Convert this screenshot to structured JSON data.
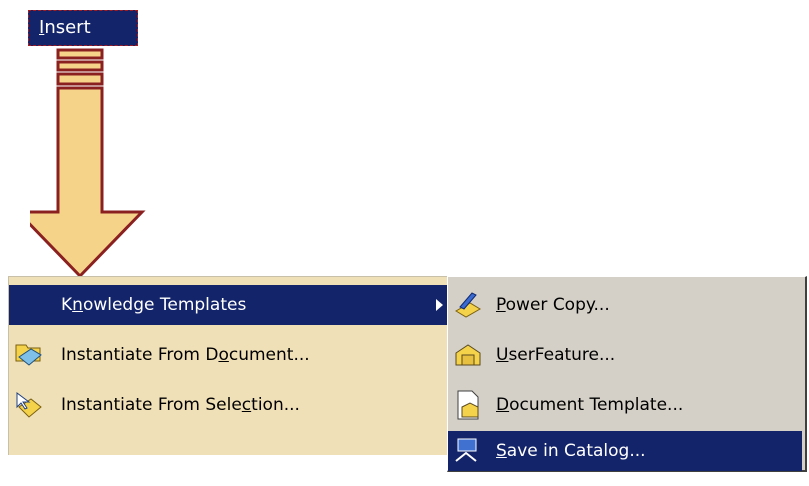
{
  "top_button": {
    "label": "Insert",
    "mnemonic_index": 0
  },
  "left_menu": {
    "items": [
      {
        "label": "Knowledge Templates",
        "mnemonic_index": 1,
        "selected": true,
        "has_submenu": true
      },
      {
        "label": "Instantiate From Document...",
        "mnemonic_index": 18,
        "icon": "document-instantiate-icon"
      },
      {
        "label": "Instantiate From Selection...",
        "mnemonic_index": 21,
        "icon": "selection-instantiate-icon"
      }
    ]
  },
  "right_menu": {
    "items": [
      {
        "label": "Power Copy...",
        "mnemonic_index": 0,
        "icon": "power-copy-icon"
      },
      {
        "label": "UserFeature...",
        "mnemonic_index": 0,
        "icon": "user-feature-icon"
      },
      {
        "label": "Document Template...",
        "mnemonic_index": 0,
        "icon": "document-template-icon"
      },
      {
        "label": "Save in Catalog...",
        "mnemonic_index": 0,
        "selected": true,
        "icon": "save-catalog-icon"
      }
    ]
  },
  "colors": {
    "menu_highlight": "#14246a",
    "arrow_fill": "#f5d48a",
    "arrow_stroke": "#8b2020",
    "left_menu_bg": "#f0e0b8",
    "right_menu_bg": "#d4d0c8"
  }
}
